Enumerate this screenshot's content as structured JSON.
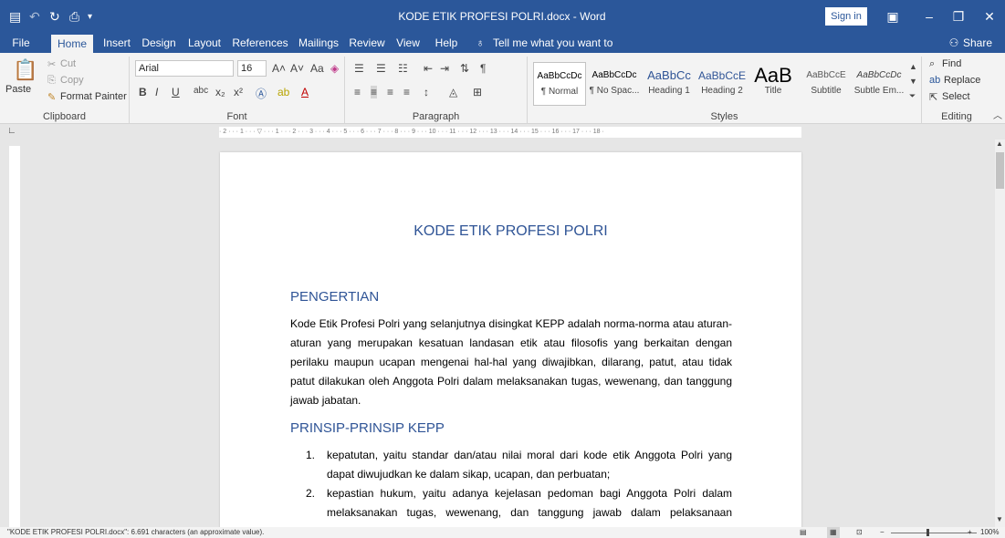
{
  "titlebar": {
    "document_title": "KODE ETIK PROFESI POLRI.docx - Word",
    "sign_in": "Sign in"
  },
  "tabs": [
    "File",
    "Home",
    "Insert",
    "Design",
    "Layout",
    "References",
    "Mailings",
    "Review",
    "View",
    "Help"
  ],
  "tell_me": "Tell me what you want to do",
  "share": "Share",
  "clipboard": {
    "paste": "Paste",
    "cut": "Cut",
    "copy": "Copy",
    "format_painter": "Format Painter",
    "label": "Clipboard"
  },
  "font": {
    "name": "Arial",
    "size": "16",
    "label": "Font"
  },
  "paragraph": {
    "label": "Paragraph"
  },
  "styles": {
    "label": "Styles",
    "items": [
      {
        "sample": "AaBbCcDc",
        "name": "¶ Normal"
      },
      {
        "sample": "AaBbCcDc",
        "name": "¶ No Spac..."
      },
      {
        "sample": "AaBbCc",
        "name": "Heading 1"
      },
      {
        "sample": "AaBbCcE",
        "name": "Heading 2"
      },
      {
        "sample": "AaB",
        "name": "Title"
      },
      {
        "sample": "AaBbCcE",
        "name": "Subtitle"
      },
      {
        "sample": "AaBbCcDc",
        "name": "Subtle Em..."
      }
    ]
  },
  "editing": {
    "find": "Find",
    "replace": "Replace",
    "select": "Select",
    "label": "Editing"
  },
  "ruler": {
    "text": "· 2 · · · 1 · · · ▽ · · · 1 · · · 2 · · · 3 · · · 4 · · · 5 · · · 6 · · · 7 · · · 8 · · · 9 · · · 10 · · · 11 · · · 12 · · · 13 · · · 14 · · · 15 · · · 16 · · · 17 · · · 18 ·"
  },
  "document": {
    "title": "KODE ETIK PROFESI POLRI",
    "section1_heading": "PENGERTIAN",
    "section1_text": "Kode Etik Profesi Polri yang selanjutnya disingkat KEPP adalah norma-norma atau aturan-aturan yang merupakan kesatuan landasan etik atau filosofis yang berkaitan dengan perilaku maupun ucapan mengenai hal-hal yang diwajibkan, dilarang, patut, atau tidak patut dilakukan oleh Anggota Polri dalam melaksanakan tugas, wewenang, dan tanggung jawab jabatan.",
    "section2_heading": "PRINSIP-PRINSIP KEPP",
    "list": [
      {
        "num": "1.",
        "text": "kepatutan, yaitu standar dan/atau nilai moral dari kode etik Anggota Polri yang dapat diwujudkan ke dalam sikap, ucapan, dan perbuatan;"
      },
      {
        "num": "2.",
        "text": "kepastian hukum, yaitu adanya kejelasan pedoman bagi Anggota Polri dalam melaksanakan tugas, wewenang, dan tanggung jawab dalam pelaksanaan penegakan"
      }
    ]
  },
  "status": {
    "text": "\"KODE ETIK PROFESI POLRI.docx\": 6.691 characters (an approximate value).",
    "zoom": "100%"
  },
  "colors": {
    "brand": "#2b579a",
    "heading": "#2f5496"
  }
}
